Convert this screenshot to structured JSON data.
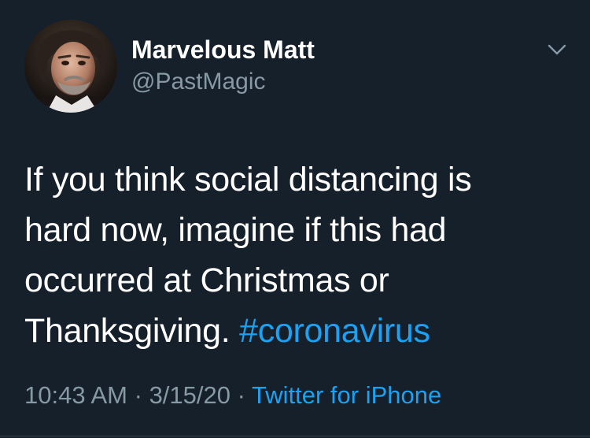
{
  "tweet": {
    "author": {
      "display_name": "Marvelous Matt",
      "handle": "@PastMagic",
      "avatar": "profile-photo"
    },
    "text_lines": [
      "If you think social distancing is",
      "hard now, imagine if this had",
      "occurred at Christmas or",
      "Thanksgiving."
    ],
    "hashtag": "#coronavirus",
    "time": "10:43 AM",
    "separator": "·",
    "date": "3/15/20",
    "source": "Twitter for iPhone",
    "menu_icon": "chevron-down-icon"
  },
  "colors": {
    "background": "#15202b",
    "primary_text": "#ffffff",
    "secondary_text": "#8899a6",
    "link": "#1da1f2"
  }
}
